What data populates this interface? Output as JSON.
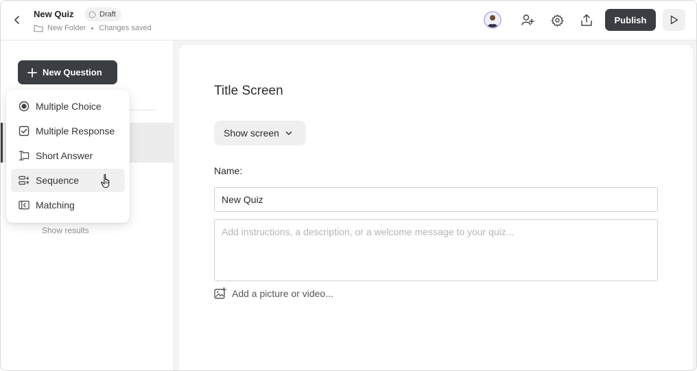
{
  "header": {
    "title": "New Quiz",
    "status_badge": "Draft",
    "folder": "New Folder",
    "save_status": "Changes saved",
    "publish_label": "Publish"
  },
  "sidebar": {
    "new_question_label": "New Question",
    "show_results_label": "Show results"
  },
  "question_type_menu": {
    "items": [
      {
        "label": "Multiple Choice",
        "icon": "radio-icon"
      },
      {
        "label": "Multiple Response",
        "icon": "checkbox-icon"
      },
      {
        "label": "Short Answer",
        "icon": "text-input-icon"
      },
      {
        "label": "Sequence",
        "icon": "sequence-icon"
      },
      {
        "label": "Matching",
        "icon": "matching-icon"
      }
    ],
    "hovered": "Sequence"
  },
  "main": {
    "section_title": "Title Screen",
    "show_screen_label": "Show screen",
    "name_label": "Name:",
    "name_value": "New Quiz",
    "description_placeholder": "Add instructions, a description, or a welcome message to your quiz...",
    "add_media_label": "Add a picture or video..."
  },
  "colors": {
    "primary_button": "#3a3d42",
    "panel_background": "#f4f4f4",
    "avatar_ring": "#c9b8e8"
  }
}
